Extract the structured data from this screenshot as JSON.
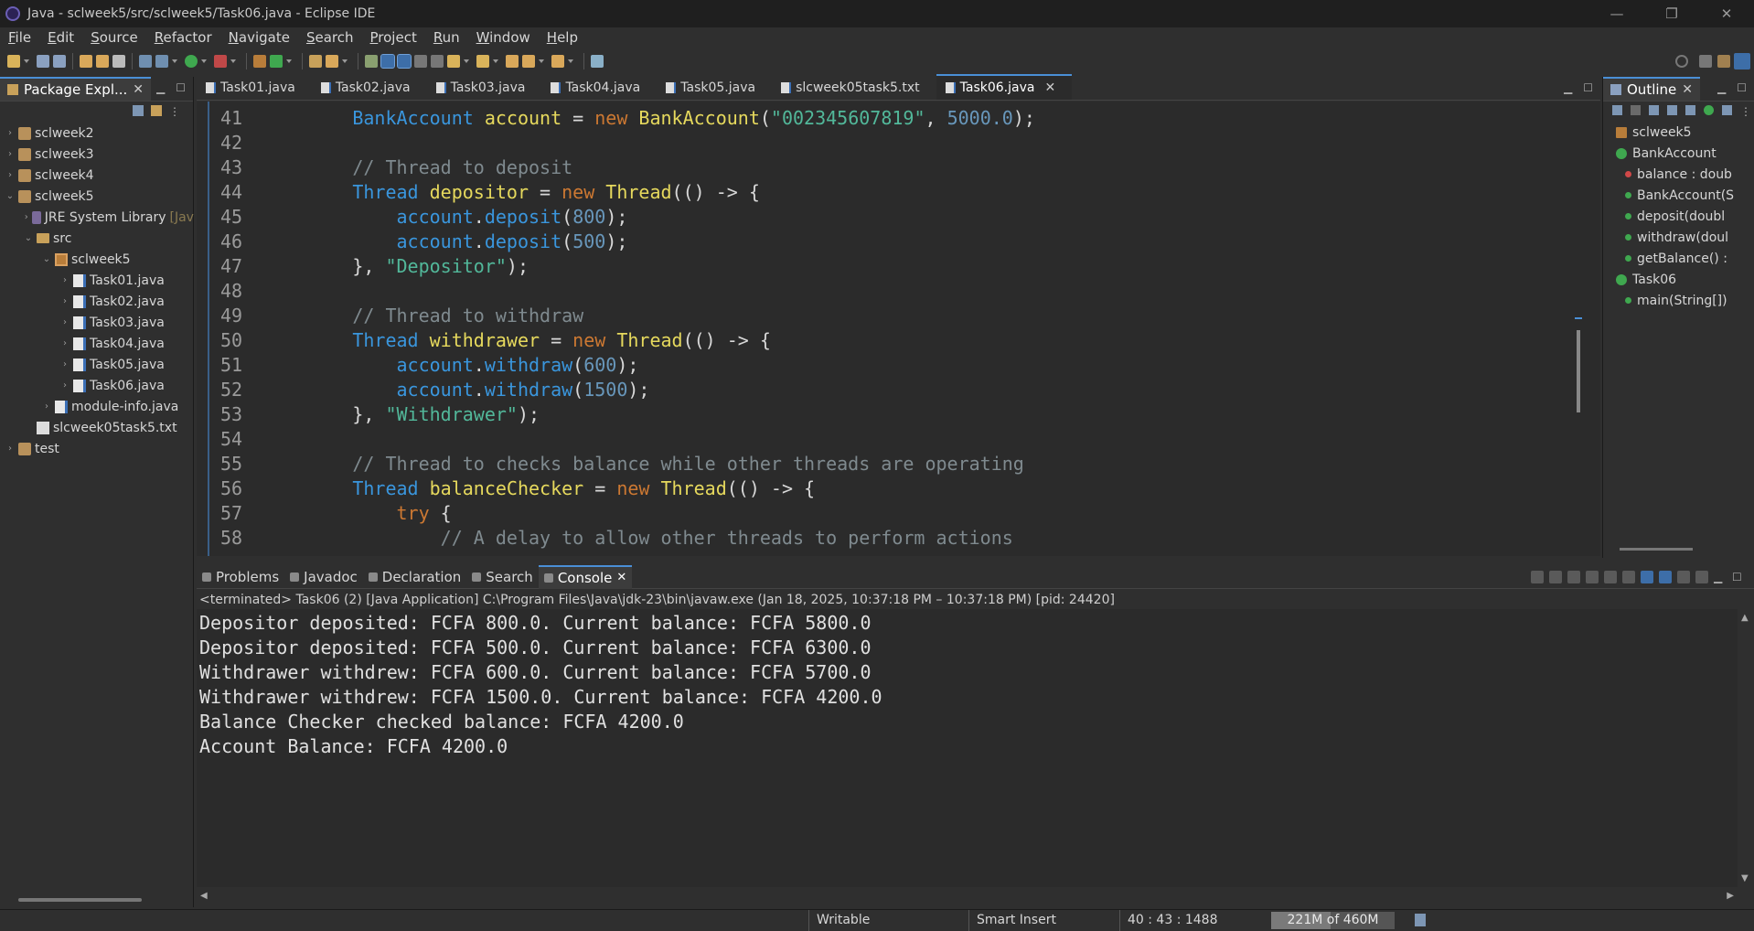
{
  "window": {
    "title": "Java - sclweek5/src/sclweek5/Task06.java - Eclipse IDE",
    "minimize": "—",
    "restore": "❐",
    "close": "✕"
  },
  "menu": [
    "File",
    "Edit",
    "Source",
    "Refactor",
    "Navigate",
    "Search",
    "Project",
    "Run",
    "Window",
    "Help"
  ],
  "package_explorer": {
    "title": "Package Expl...",
    "items": [
      {
        "label": "sclweek2",
        "level": 0,
        "icon": "project-icon"
      },
      {
        "label": "sclweek3",
        "level": 0,
        "icon": "project-icon"
      },
      {
        "label": "sclweek4",
        "level": 0,
        "icon": "project-icon"
      },
      {
        "label": "sclweek5",
        "level": 0,
        "icon": "project-icon",
        "expanded": true
      },
      {
        "label": "JRE System Library",
        "suffix": "[Jav",
        "level": 1,
        "icon": "library-icon"
      },
      {
        "label": "src",
        "level": 1,
        "icon": "folder-icon",
        "expanded": true
      },
      {
        "label": "sclweek5",
        "level": 2,
        "icon": "package-icon",
        "expanded": true
      },
      {
        "label": "Task01.java",
        "level": 3,
        "icon": "java-file-icon"
      },
      {
        "label": "Task02.java",
        "level": 3,
        "icon": "java-file-icon"
      },
      {
        "label": "Task03.java",
        "level": 3,
        "icon": "java-file-icon"
      },
      {
        "label": "Task04.java",
        "level": 3,
        "icon": "java-file-icon"
      },
      {
        "label": "Task05.java",
        "level": 3,
        "icon": "java-file-icon"
      },
      {
        "label": "Task06.java",
        "level": 3,
        "icon": "java-file-icon"
      },
      {
        "label": "module-info.java",
        "level": 2,
        "icon": "java-file-icon"
      },
      {
        "label": "slcweek05task5.txt",
        "level": 1,
        "icon": "text-file-icon",
        "leaf": true
      },
      {
        "label": "test",
        "level": 0,
        "icon": "project-icon"
      }
    ]
  },
  "editor": {
    "tabs": [
      "Task01.java",
      "Task02.java",
      "Task03.java",
      "Task04.java",
      "Task05.java",
      "slcweek05task5.txt",
      "Task06.java"
    ],
    "active_tab": "Task06.java",
    "lines": [
      {
        "n": "41",
        "tokens": [
          [
            "tx",
            "        "
          ],
          [
            "ty",
            "BankAccount"
          ],
          [
            "tx",
            " "
          ],
          [
            "var",
            "account"
          ],
          [
            "tx",
            " = "
          ],
          [
            "kw",
            "new"
          ],
          [
            "tx",
            " "
          ],
          [
            "var",
            "BankAccount"
          ],
          [
            "tx",
            "("
          ],
          [
            "str",
            "\"002345607819\""
          ],
          [
            "tx",
            ", "
          ],
          [
            "num",
            "5000.0"
          ],
          [
            "tx",
            ");"
          ]
        ]
      },
      {
        "n": "42",
        "tokens": []
      },
      {
        "n": "43",
        "tokens": [
          [
            "tx",
            "        "
          ],
          [
            "cm",
            "// Thread to deposit"
          ]
        ]
      },
      {
        "n": "44",
        "tokens": [
          [
            "tx",
            "        "
          ],
          [
            "ty",
            "Thread"
          ],
          [
            "tx",
            " "
          ],
          [
            "var",
            "depositor"
          ],
          [
            "tx",
            " = "
          ],
          [
            "kw",
            "new"
          ],
          [
            "tx",
            " "
          ],
          [
            "var",
            "Thread"
          ],
          [
            "tx",
            "(() -> {"
          ]
        ]
      },
      {
        "n": "45",
        "tokens": [
          [
            "tx",
            "            "
          ],
          [
            "ty",
            "account"
          ],
          [
            "tx",
            "."
          ],
          [
            "ty",
            "deposit"
          ],
          [
            "tx",
            "("
          ],
          [
            "num",
            "800"
          ],
          [
            "tx",
            ");"
          ]
        ]
      },
      {
        "n": "46",
        "tokens": [
          [
            "tx",
            "            "
          ],
          [
            "ty",
            "account"
          ],
          [
            "tx",
            "."
          ],
          [
            "ty",
            "deposit"
          ],
          [
            "tx",
            "("
          ],
          [
            "num",
            "500"
          ],
          [
            "tx",
            ");"
          ]
        ]
      },
      {
        "n": "47",
        "tokens": [
          [
            "tx",
            "        }, "
          ],
          [
            "str",
            "\"Depositor\""
          ],
          [
            "tx",
            ");"
          ]
        ]
      },
      {
        "n": "48",
        "tokens": []
      },
      {
        "n": "49",
        "tokens": [
          [
            "tx",
            "        "
          ],
          [
            "cm",
            "// Thread to withdraw"
          ]
        ]
      },
      {
        "n": "50",
        "tokens": [
          [
            "tx",
            "        "
          ],
          [
            "ty",
            "Thread"
          ],
          [
            "tx",
            " "
          ],
          [
            "var",
            "withdrawer"
          ],
          [
            "tx",
            " = "
          ],
          [
            "kw",
            "new"
          ],
          [
            "tx",
            " "
          ],
          [
            "var",
            "Thread"
          ],
          [
            "tx",
            "(() -> {"
          ]
        ]
      },
      {
        "n": "51",
        "tokens": [
          [
            "tx",
            "            "
          ],
          [
            "ty",
            "account"
          ],
          [
            "tx",
            "."
          ],
          [
            "ty",
            "withdraw"
          ],
          [
            "tx",
            "("
          ],
          [
            "num",
            "600"
          ],
          [
            "tx",
            ");"
          ]
        ]
      },
      {
        "n": "52",
        "tokens": [
          [
            "tx",
            "            "
          ],
          [
            "ty",
            "account"
          ],
          [
            "tx",
            "."
          ],
          [
            "ty",
            "withdraw"
          ],
          [
            "tx",
            "("
          ],
          [
            "num",
            "1500"
          ],
          [
            "tx",
            ");"
          ]
        ]
      },
      {
        "n": "53",
        "tokens": [
          [
            "tx",
            "        }, "
          ],
          [
            "str",
            "\"Withdrawer\""
          ],
          [
            "tx",
            ");"
          ]
        ]
      },
      {
        "n": "54",
        "tokens": []
      },
      {
        "n": "55",
        "tokens": [
          [
            "tx",
            "        "
          ],
          [
            "cm",
            "// Thread to checks balance while other threads are operating"
          ]
        ]
      },
      {
        "n": "56",
        "tokens": [
          [
            "tx",
            "        "
          ],
          [
            "ty",
            "Thread"
          ],
          [
            "tx",
            " "
          ],
          [
            "var",
            "balanceChecker"
          ],
          [
            "tx",
            " = "
          ],
          [
            "kw",
            "new"
          ],
          [
            "tx",
            " "
          ],
          [
            "var",
            "Thread"
          ],
          [
            "tx",
            "(() -> {"
          ]
        ]
      },
      {
        "n": "57",
        "tokens": [
          [
            "tx",
            "            "
          ],
          [
            "kw",
            "try"
          ],
          [
            "tx",
            " {"
          ]
        ]
      },
      {
        "n": "58",
        "tokens": [
          [
            "tx",
            "                "
          ],
          [
            "cm",
            "// A delay to allow other threads to perform actions"
          ]
        ]
      }
    ]
  },
  "outline": {
    "title": "Outline",
    "items": [
      {
        "label": "sclweek5",
        "level": 0,
        "icon": "package-icon",
        "color": "#b87d3a"
      },
      {
        "label": "BankAccount",
        "level": 0,
        "icon": "class-icon",
        "color": "#3fa84f"
      },
      {
        "label": "balance : doub",
        "level": 1,
        "icon": "private-field-icon",
        "color": "#d04848"
      },
      {
        "label": "BankAccount(S",
        "level": 1,
        "icon": "constructor-icon",
        "color": "#3fa84f"
      },
      {
        "label": "deposit(doubl",
        "level": 1,
        "icon": "method-icon",
        "color": "#3fa84f"
      },
      {
        "label": "withdraw(doul",
        "level": 1,
        "icon": "method-icon",
        "color": "#3fa84f"
      },
      {
        "label": "getBalance() :",
        "level": 1,
        "icon": "method-icon",
        "color": "#3fa84f"
      },
      {
        "label": "Task06",
        "level": 0,
        "icon": "class-icon",
        "color": "#3fa84f"
      },
      {
        "label": "main(String[])",
        "level": 1,
        "icon": "static-method-icon",
        "color": "#3fa84f"
      }
    ]
  },
  "console": {
    "tabs": [
      {
        "label": "Problems",
        "icon": "problems-icon"
      },
      {
        "label": "Javadoc",
        "icon": "javadoc-icon"
      },
      {
        "label": "Declaration",
        "icon": "declaration-icon"
      },
      {
        "label": "Search",
        "icon": "search-icon"
      },
      {
        "label": "Console",
        "icon": "console-icon",
        "active": true
      }
    ],
    "description": "<terminated> Task06 (2) [Java Application] C:\\Program Files\\Java\\jdk-23\\bin\\javaw.exe  (Jan 18, 2025, 10:37:18 PM – 10:37:18 PM) [pid: 24420]",
    "output": [
      "Depositor deposited: FCFA 800.0. Current balance: FCFA 5800.0",
      "Depositor deposited: FCFA 500.0. Current balance: FCFA 6300.0",
      "Withdrawer withdrew: FCFA 600.0. Current balance: FCFA 5700.0",
      "Withdrawer withdrew: FCFA 1500.0. Current balance: FCFA 4200.0",
      "Balance Checker checked balance: FCFA 4200.0",
      "Account Balance: FCFA 4200.0"
    ]
  },
  "status": {
    "writable": "Writable",
    "insert_mode": "Smart Insert",
    "position": "40 : 43 : 1488",
    "heap": "221M of 460M",
    "heap_used_fraction": 0.48
  },
  "colors": {
    "accent": "#4a8fd6",
    "keyword": "#cc7832",
    "type": "#3a96dd",
    "identifier": "#e6d95d",
    "string": "#52b89a",
    "number": "#6897bb",
    "comment": "#7f8a8f"
  }
}
